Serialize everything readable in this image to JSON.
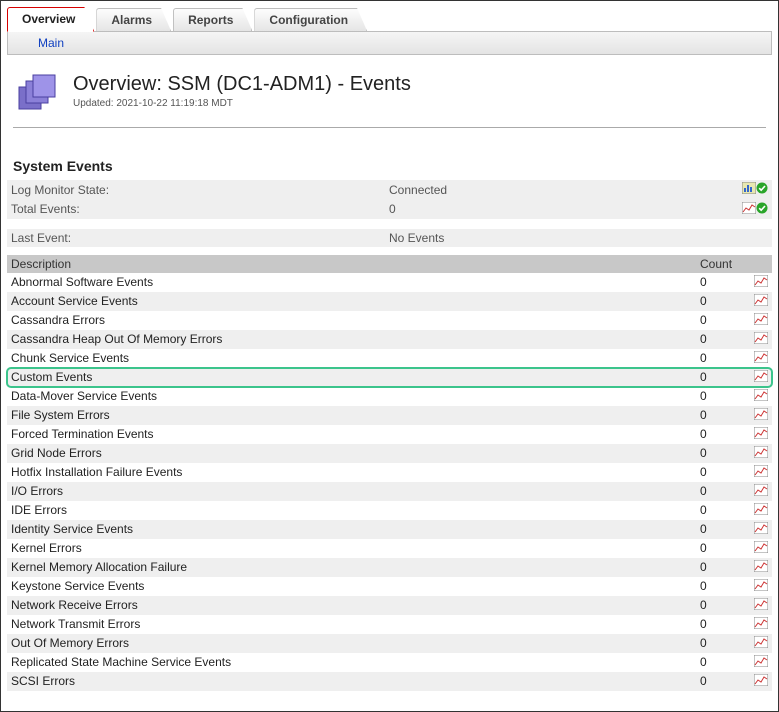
{
  "tabs": [
    "Overview",
    "Alarms",
    "Reports",
    "Configuration"
  ],
  "active_tab": 0,
  "subnav": {
    "main": "Main"
  },
  "header": {
    "title": "Overview: SSM (DC1-ADM1) - Events",
    "updated": "Updated: 2021-10-22 11:19:18 MDT"
  },
  "section_title": "System Events",
  "summary": {
    "log_monitor_label": "Log Monitor State:",
    "log_monitor_value": "Connected",
    "total_events_label": "Total Events:",
    "total_events_value": "0",
    "last_event_label": "Last Event:",
    "last_event_value": "No Events"
  },
  "columns": {
    "description": "Description",
    "count": "Count"
  },
  "events": [
    {
      "desc": "Abnormal Software Events",
      "count": "0"
    },
    {
      "desc": "Account Service Events",
      "count": "0"
    },
    {
      "desc": "Cassandra Errors",
      "count": "0"
    },
    {
      "desc": "Cassandra Heap Out Of Memory Errors",
      "count": "0"
    },
    {
      "desc": "Chunk Service Events",
      "count": "0"
    },
    {
      "desc": "Custom Events",
      "count": "0",
      "highlight": true
    },
    {
      "desc": "Data-Mover Service Events",
      "count": "0"
    },
    {
      "desc": "File System Errors",
      "count": "0"
    },
    {
      "desc": "Forced Termination Events",
      "count": "0"
    },
    {
      "desc": "Grid Node Errors",
      "count": "0"
    },
    {
      "desc": "Hotfix Installation Failure Events",
      "count": "0"
    },
    {
      "desc": "I/O Errors",
      "count": "0"
    },
    {
      "desc": "IDE Errors",
      "count": "0"
    },
    {
      "desc": "Identity Service Events",
      "count": "0"
    },
    {
      "desc": "Kernel Errors",
      "count": "0"
    },
    {
      "desc": "Kernel Memory Allocation Failure",
      "count": "0"
    },
    {
      "desc": "Keystone Service Events",
      "count": "0"
    },
    {
      "desc": "Network Receive Errors",
      "count": "0"
    },
    {
      "desc": "Network Transmit Errors",
      "count": "0"
    },
    {
      "desc": "Out Of Memory Errors",
      "count": "0"
    },
    {
      "desc": "Replicated State Machine Service Events",
      "count": "0"
    },
    {
      "desc": "SCSI Errors",
      "count": "0"
    }
  ]
}
